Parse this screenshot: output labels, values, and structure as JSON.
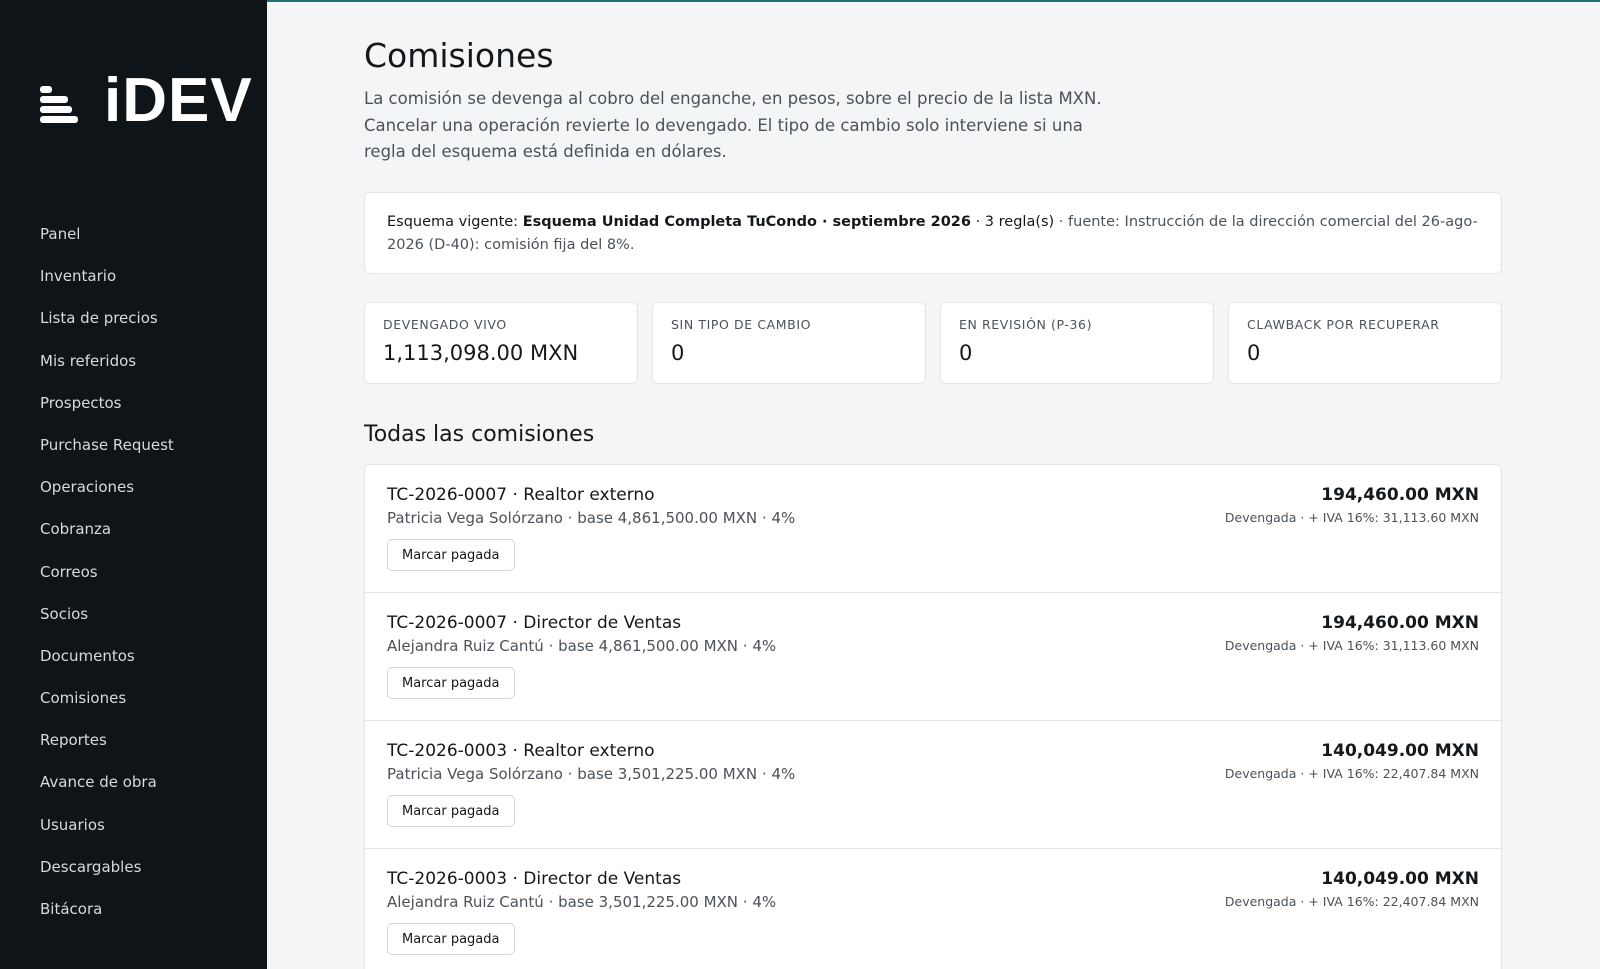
{
  "brand": {
    "name": "iDEV"
  },
  "nav": [
    "Panel",
    "Inventario",
    "Lista de precios",
    "Mis referidos",
    "Prospectos",
    "Purchase Request",
    "Operaciones",
    "Cobranza",
    "Correos",
    "Socios",
    "Documentos",
    "Comisiones",
    "Reportes",
    "Avance de obra",
    "Usuarios",
    "Descargables",
    "Bitácora"
  ],
  "page": {
    "title": "Comisiones",
    "intro": "La comisión se devenga al cobro del enganche, en pesos, sobre el precio de la lista MXN. Cancelar una operación revierte lo devengado. El tipo de cambio solo interviene si una regla del esquema está definida en dólares."
  },
  "scheme": {
    "prefix": "Esquema vigente: ",
    "name": "Esquema Unidad Completa TuCondo · septiembre 2026",
    "rules": " · 3 regla(s)",
    "source": " · fuente: Instrucción de la dirección comercial del 26-ago-2026 (D-40): comisión fija del 8%."
  },
  "kpis": [
    {
      "label": "Devengado vivo",
      "value": "1,113,098.00 MXN"
    },
    {
      "label": "Sin tipo de cambio",
      "value": "0"
    },
    {
      "label": "En revisión (P-36)",
      "value": "0"
    },
    {
      "label": "Clawback por recuperar",
      "value": "0"
    }
  ],
  "section_title": "Todas las comisiones",
  "pay_label": "Marcar pagada",
  "commissions": [
    {
      "title": "TC-2026-0007 · Realtor externo",
      "sub": "Patricia Vega Solórzano · base 4,861,500.00 MXN · 4%",
      "amount": "194,460.00 MXN",
      "note": "Devengada · + IVA 16%: 31,113.60 MXN"
    },
    {
      "title": "TC-2026-0007 · Director de Ventas",
      "sub": "Alejandra Ruiz Cantú · base 4,861,500.00 MXN · 4%",
      "amount": "194,460.00 MXN",
      "note": "Devengada · + IVA 16%: 31,113.60 MXN"
    },
    {
      "title": "TC-2026-0003 · Realtor externo",
      "sub": "Patricia Vega Solórzano · base 3,501,225.00 MXN · 4%",
      "amount": "140,049.00 MXN",
      "note": "Devengada · + IVA 16%: 22,407.84 MXN"
    },
    {
      "title": "TC-2026-0003 · Director de Ventas",
      "sub": "Alejandra Ruiz Cantú · base 3,501,225.00 MXN · 4%",
      "amount": "140,049.00 MXN",
      "note": "Devengada · + IVA 16%: 22,407.84 MXN"
    }
  ]
}
